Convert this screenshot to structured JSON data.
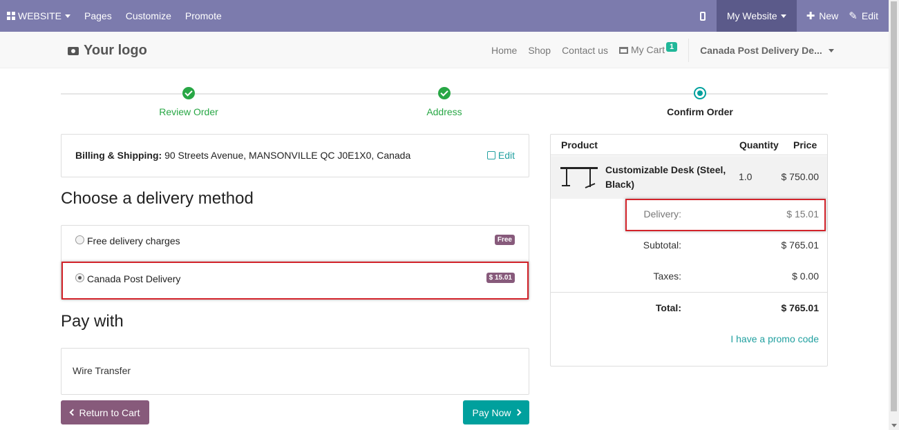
{
  "topbar": {
    "brand": "WEBSITE",
    "menu": [
      "Pages",
      "Customize",
      "Promote"
    ],
    "mywebsite": "My Website",
    "new": "New",
    "edit": "Edit"
  },
  "header": {
    "logo": "Your logo",
    "nav": [
      "Home",
      "Shop",
      "Contact us"
    ],
    "cart_label": "My Cart",
    "cart_count": "1",
    "delivery_dropdown": "Canada Post Delivery De..."
  },
  "wizard": {
    "steps": [
      {
        "label": "Review Order",
        "state": "done"
      },
      {
        "label": "Address",
        "state": "done"
      },
      {
        "label": "Confirm Order",
        "state": "current"
      }
    ]
  },
  "billing": {
    "label": "Billing & Shipping:",
    "address": " 90 Streets Avenue, MANSONVILLE QC J0E1X0, Canada",
    "edit": "Edit"
  },
  "delivery": {
    "title": "Choose a delivery method",
    "options": [
      {
        "label": "Free delivery charges",
        "badge": "Free",
        "selected": false
      },
      {
        "label": "Canada Post Delivery",
        "badge": "$ 15.01",
        "selected": true
      }
    ]
  },
  "payment": {
    "title": "Pay with",
    "method": "Wire Transfer",
    "return_label": "Return to Cart",
    "pay_label": "Pay Now"
  },
  "summary": {
    "headers": {
      "product": "Product",
      "quantity": "Quantity",
      "price": "Price"
    },
    "product": {
      "name": "Customizable Desk (Steel, Black)",
      "quantity": "1.0",
      "price": "$ 750.00"
    },
    "delivery": {
      "label": "Delivery:",
      "value": "$ 15.01"
    },
    "subtotal": {
      "label": "Subtotal:",
      "value": "$ 765.01"
    },
    "taxes": {
      "label": "Taxes:",
      "value": "$ 0.00"
    },
    "total": {
      "label": "Total:",
      "value": "$ 765.01"
    },
    "promo": "I have a promo code"
  },
  "colors": {
    "admin_bar": "#7c7bad",
    "primary": "#00a09d",
    "secondary": "#875a7b",
    "success": "#28a745",
    "highlight": "#d3232a"
  }
}
